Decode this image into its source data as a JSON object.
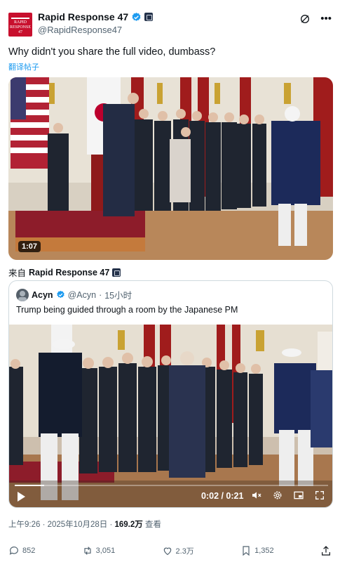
{
  "author": {
    "name": "Rapid Response 47",
    "handle": "@RapidResponse47",
    "avatar_text": "RAPID RESPONSE 47"
  },
  "header_icons": [
    "grok-icon",
    "more-icon"
  ],
  "tweet": {
    "text": "Why didn't you share the full video, dumbass?",
    "translate_label": "翻译帖子",
    "video_duration": "1:07"
  },
  "from_line": {
    "prefix": "来自",
    "name": "Rapid Response 47"
  },
  "quoted_tweet": {
    "name": "Acyn",
    "handle": "@Acyn",
    "time": "15小时",
    "text": "Trump being guided through a room by the Japanese PM",
    "video_time": "0:02 / 0:21",
    "progress": 0.095
  },
  "meta": {
    "time": "上午9:26 · 2025年10月28日 · ",
    "views": "169.2万",
    "views_label": " 查看"
  },
  "actions": {
    "replies": "852",
    "reposts": "3,051",
    "likes": "2.3万",
    "bookmarks": "1,352"
  },
  "colors": {
    "accent": "#1d9bf0",
    "brand_red": "#c8102e",
    "muted": "#536471"
  }
}
